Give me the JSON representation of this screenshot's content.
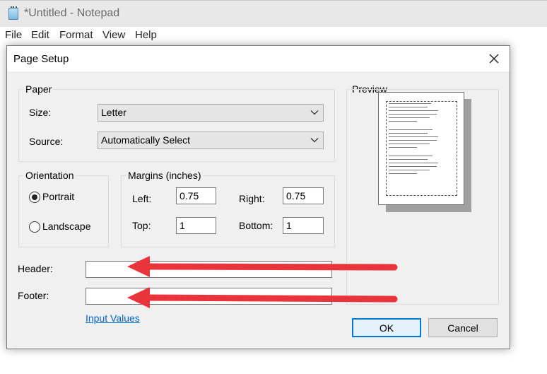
{
  "notepad": {
    "title": "*Untitled - Notepad",
    "menu": [
      "File",
      "Edit",
      "Format",
      "View",
      "Help"
    ]
  },
  "dialog": {
    "title": "Page Setup",
    "close_icon": "close-icon",
    "paper": {
      "group_label": "Paper",
      "size_label": "Size:",
      "size_value": "Letter",
      "source_label": "Source:",
      "source_value": "Automatically Select"
    },
    "orientation": {
      "group_label": "Orientation",
      "portrait_label": "Portrait",
      "landscape_label": "Landscape",
      "selected": "Portrait"
    },
    "margins": {
      "group_label": "Margins (inches)",
      "left_label": "Left:",
      "left_value": "0.75",
      "right_label": "Right:",
      "right_value": "0.75",
      "top_label": "Top:",
      "top_value": "1",
      "bottom_label": "Bottom:",
      "bottom_value": "1"
    },
    "header_label": "Header:",
    "header_value": "",
    "footer_label": "Footer:",
    "footer_value": "",
    "input_values_link": "Input Values",
    "preview_label": "Preview",
    "ok_label": "OK",
    "cancel_label": "Cancel"
  },
  "colors": {
    "annotation_arrow": "#e8343a",
    "accent": "#0078d7",
    "link": "#0066cc"
  }
}
